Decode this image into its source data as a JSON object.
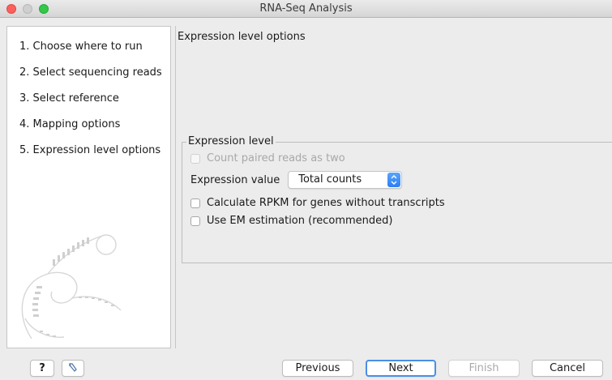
{
  "window": {
    "title": "RNA-Seq Analysis"
  },
  "steps": [
    {
      "label": "1. Choose where to run"
    },
    {
      "label": "2. Select sequencing reads"
    },
    {
      "label": "3. Select reference"
    },
    {
      "label": "4. Mapping options"
    },
    {
      "label": "5. Expression level options"
    }
  ],
  "content": {
    "heading": "Expression level options",
    "group_title": "Expression level",
    "count_paired_label": "Count paired reads as two",
    "count_paired_checked": false,
    "count_paired_enabled": false,
    "expression_value_label": "Expression value",
    "expression_value_selected": "Total counts",
    "rpkm_label": "Calculate RPKM for genes without transcripts",
    "rpkm_checked": false,
    "em_label": "Use EM estimation (recommended)",
    "em_checked": false
  },
  "buttons": {
    "help": "?",
    "previous": "Previous",
    "next": "Next",
    "finish": "Finish",
    "cancel": "Cancel"
  },
  "icons": {
    "close": "close-icon",
    "minimize": "minimize-icon",
    "zoom": "zoom-icon",
    "select_arrows": "up-down-chevron-icon",
    "restore": "restore-defaults-icon",
    "watermark": "dna-spiral-watermark-icon"
  },
  "colors": {
    "accent": "#2d7ef3",
    "close": "#fc605c",
    "zoom": "#34c84a"
  }
}
